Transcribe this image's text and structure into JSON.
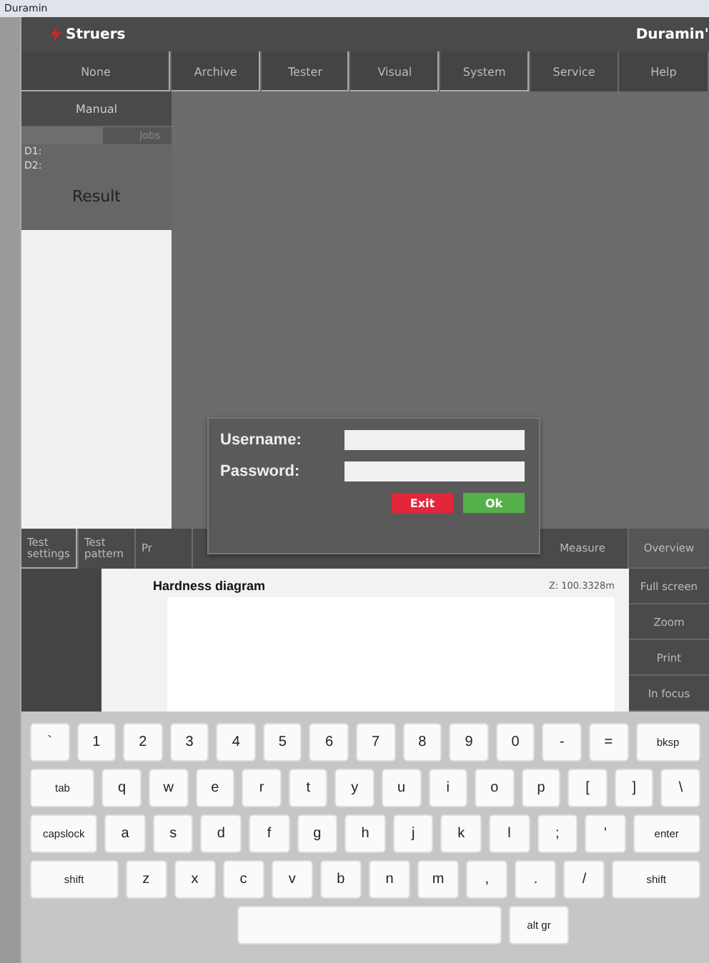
{
  "window": {
    "title": "Duramin"
  },
  "header": {
    "logo": "Struers",
    "product": "Duramin'"
  },
  "menu": [
    {
      "label": "None",
      "corner": true
    },
    {
      "label": "Archive",
      "corner": true
    },
    {
      "label": "Tester",
      "corner": true
    },
    {
      "label": "Visual",
      "corner": true
    },
    {
      "label": "System",
      "corner": true
    },
    {
      "label": "Service",
      "corner": false
    },
    {
      "label": "Help",
      "corner": false
    }
  ],
  "left_panel": {
    "mode_button": "Manual",
    "job_button": "Jobs",
    "readings": [
      "D1:",
      "D2:"
    ],
    "result_label": "Result"
  },
  "login_dialog": {
    "username_label": "Username:",
    "password_label": "Password:",
    "buttons": [
      {
        "label": "Exit",
        "kind": "cancel"
      },
      {
        "label": "Ok",
        "kind": "confirm"
      }
    ]
  },
  "toolbar": [
    {
      "label": "Test settings",
      "corner": true
    },
    {
      "label": "Test pattern",
      "corner": false
    },
    {
      "label": "Pr",
      "corner": false
    },
    {
      "label": "Measure",
      "corner": false
    }
  ],
  "side_buttons": [
    "Overview",
    "Full screen",
    "Zoom",
    "Print",
    "In focus"
  ],
  "diagram": {
    "title": "Hardness diagram",
    "z_reading": "Z: 100.3328m"
  },
  "keyboard": [
    [
      {
        "label": "`",
        "kind": "char"
      },
      {
        "label": "1",
        "kind": "char"
      },
      {
        "label": "2",
        "kind": "char"
      },
      {
        "label": "3",
        "kind": "char"
      },
      {
        "label": "4",
        "kind": "char"
      },
      {
        "label": "5",
        "kind": "char"
      },
      {
        "label": "6",
        "kind": "char"
      },
      {
        "label": "7",
        "kind": "char"
      },
      {
        "label": "8",
        "kind": "char"
      },
      {
        "label": "9",
        "kind": "char"
      },
      {
        "label": "0",
        "kind": "char"
      },
      {
        "label": "-",
        "kind": "char"
      },
      {
        "label": "=",
        "kind": "char"
      },
      {
        "label": "bksp",
        "kind": "wide"
      }
    ],
    [
      {
        "label": "tab",
        "kind": "wide"
      },
      {
        "label": "q",
        "kind": "char"
      },
      {
        "label": "w",
        "kind": "char"
      },
      {
        "label": "e",
        "kind": "char"
      },
      {
        "label": "r",
        "kind": "char"
      },
      {
        "label": "t",
        "kind": "char"
      },
      {
        "label": "y",
        "kind": "char"
      },
      {
        "label": "u",
        "kind": "char"
      },
      {
        "label": "i",
        "kind": "char"
      },
      {
        "label": "o",
        "kind": "char"
      },
      {
        "label": "p",
        "kind": "char"
      },
      {
        "label": "[",
        "kind": "char"
      },
      {
        "label": "]",
        "kind": "char"
      },
      {
        "label": "\\",
        "kind": "char"
      }
    ],
    [
      {
        "label": "capslock",
        "kind": "wide"
      },
      {
        "label": "a",
        "kind": "char"
      },
      {
        "label": "s",
        "kind": "char"
      },
      {
        "label": "d",
        "kind": "char"
      },
      {
        "label": "f",
        "kind": "char"
      },
      {
        "label": "g",
        "kind": "char"
      },
      {
        "label": "h",
        "kind": "char"
      },
      {
        "label": "j",
        "kind": "char"
      },
      {
        "label": "k",
        "kind": "char"
      },
      {
        "label": "l",
        "kind": "char"
      },
      {
        "label": ";",
        "kind": "char"
      },
      {
        "label": "'",
        "kind": "char"
      },
      {
        "label": "enter",
        "kind": "wide"
      }
    ],
    [
      {
        "label": "shift",
        "kind": "wider"
      },
      {
        "label": "z",
        "kind": "char"
      },
      {
        "label": "x",
        "kind": "char"
      },
      {
        "label": "c",
        "kind": "char"
      },
      {
        "label": "v",
        "kind": "char"
      },
      {
        "label": "b",
        "kind": "char"
      },
      {
        "label": "n",
        "kind": "char"
      },
      {
        "label": "m",
        "kind": "char"
      },
      {
        "label": ",",
        "kind": "char"
      },
      {
        "label": ".",
        "kind": "char"
      },
      {
        "label": "/",
        "kind": "char"
      },
      {
        "label": "shift",
        "kind": "wider"
      }
    ],
    [
      {
        "kind": "space"
      },
      {
        "label": "alt gr",
        "kind": "wide"
      }
    ]
  ]
}
